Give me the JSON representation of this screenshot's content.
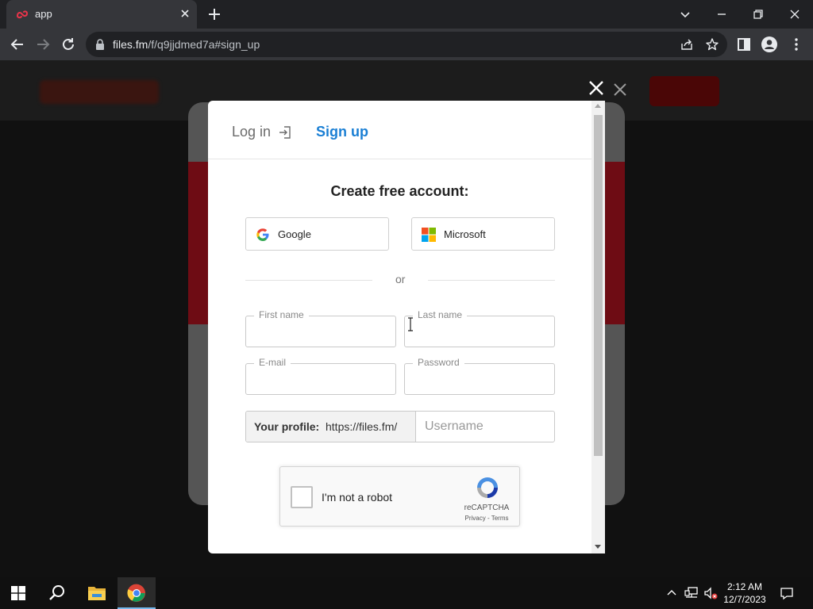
{
  "browser": {
    "tab_title": "app",
    "url_host": "files.fm",
    "url_path": "/f/q9jjdmed7a#sign_up"
  },
  "modal": {
    "tab_login": "Log in",
    "tab_signup": "Sign up",
    "heading": "Create free account:",
    "google_label": "Google",
    "microsoft_label": "Microsoft",
    "or_text": "or",
    "first_name_label": "First name",
    "last_name_label": "Last name",
    "email_label": "E-mail",
    "password_label": "Password",
    "profile_label": "Your profile:",
    "profile_url": "https://files.fm/",
    "username_placeholder": "Username"
  },
  "captcha": {
    "text": "I'm not a robot",
    "brand": "reCAPTCHA",
    "terms": "Privacy - Terms"
  },
  "taskbar": {
    "time": "2:12 AM",
    "date": "12/7/2023"
  },
  "colors": {
    "accent": "#1a7fd4",
    "chrome_dark": "#202124",
    "chrome_toolbar": "#35363a"
  }
}
